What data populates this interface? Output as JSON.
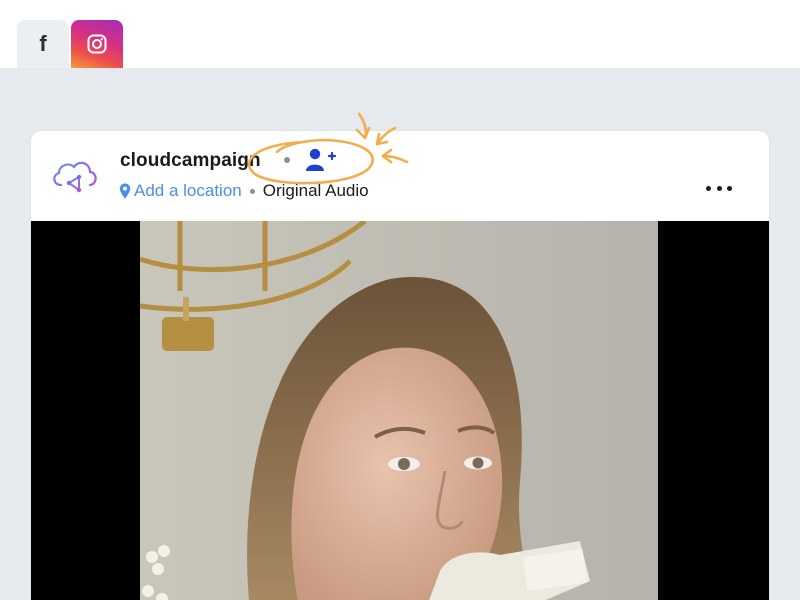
{
  "tabs": [
    {
      "name": "facebook",
      "icon": "facebook-icon",
      "glyph": "f"
    },
    {
      "name": "instagram",
      "icon": "instagram-icon"
    }
  ],
  "post": {
    "username": "cloudcampaign",
    "location_link": "Add a location",
    "audio_label": "Original Audio",
    "avatar_icon": "cloudcampaign-logo",
    "follow_icon": "add-user-icon",
    "more_icon": "more-options-icon"
  },
  "annotation": {
    "color": "#f2ad4e",
    "shape": "hand-drawn circle with arrows"
  },
  "colors": {
    "accent_link": "#4a90e2",
    "follow_icon": "#1f3fd1",
    "canvas_background": "#e6e9ee"
  }
}
